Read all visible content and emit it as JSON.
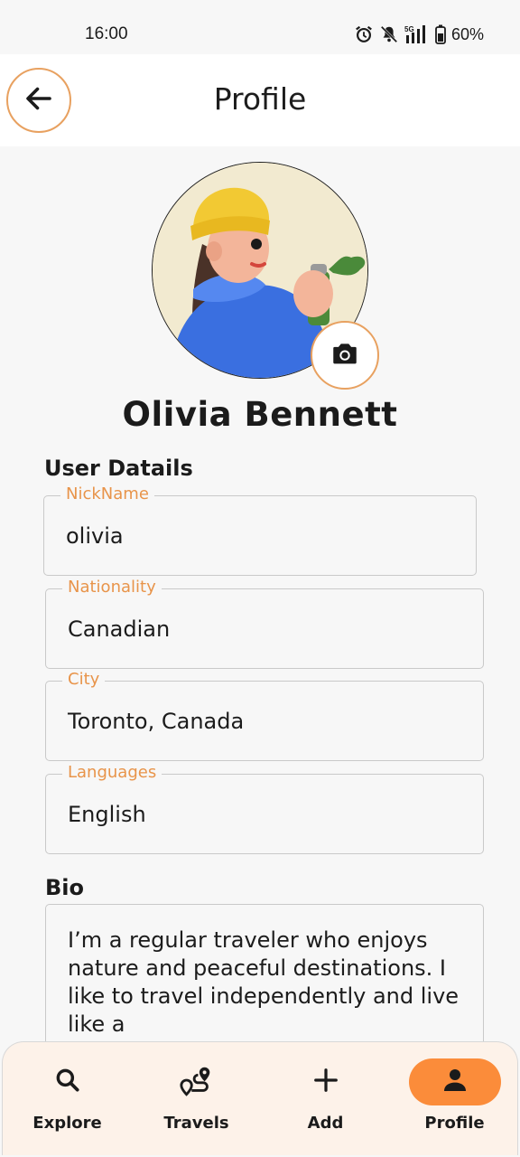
{
  "status_bar": {
    "time": "16:00",
    "battery": "60%",
    "icons": [
      "alarm-icon",
      "mute-icon",
      "5g-signal-icon",
      "battery-icon"
    ]
  },
  "header": {
    "title": "Profile",
    "back_icon": "arrow-left-icon"
  },
  "profile": {
    "name": "Olivia Bennett",
    "camera_icon": "camera-icon"
  },
  "user_details": {
    "title": "User Datails",
    "fields": [
      {
        "label": "NickName",
        "value": "olivia"
      },
      {
        "label": "Nationality",
        "value": "Canadian"
      },
      {
        "label": "City",
        "value": "Toronto, Canada"
      },
      {
        "label": "Languages",
        "value": "English"
      }
    ]
  },
  "bio": {
    "title": "Bio",
    "text": "I’m a regular traveler who enjoys nature and peaceful destinations. I like to travel independently and live like a"
  },
  "nav": {
    "items": [
      {
        "label": "Explore",
        "icon": "search-icon"
      },
      {
        "label": "Travels",
        "icon": "route-icon"
      },
      {
        "label": "Add",
        "icon": "plus-icon"
      },
      {
        "label": "Profile",
        "icon": "person-icon"
      }
    ],
    "active": "Profile"
  },
  "colors": {
    "accent": "#fb8c3a",
    "label": "#e8944a",
    "nav_background": "#fdf2e9"
  }
}
